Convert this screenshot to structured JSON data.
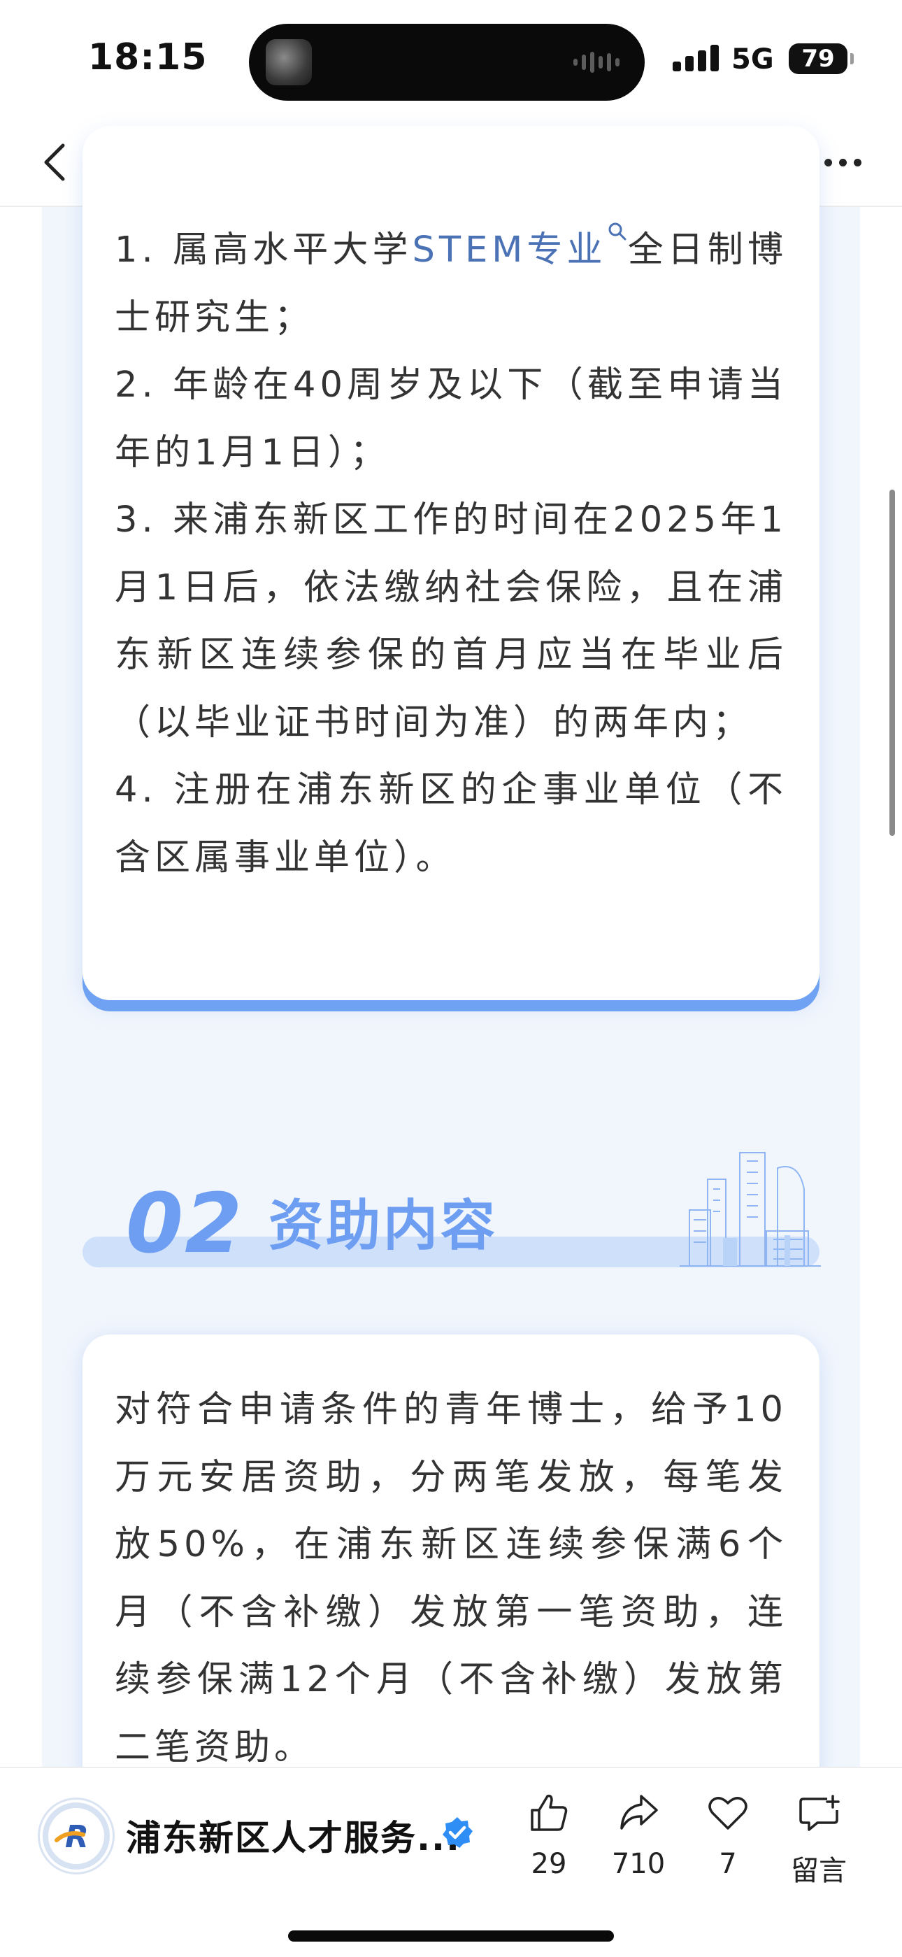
{
  "status_bar": {
    "time": "18:15",
    "network": "5G",
    "battery": "79"
  },
  "nav": {
    "back_icon": "chevron-left-icon",
    "more_icon": "more-dots-icon"
  },
  "section1": {
    "requirements": [
      {
        "prefix": "1. 属高水平大学",
        "link": "STEM专业",
        "suffix": "全日制博士研究生；"
      },
      {
        "text": "2. 年龄在40周岁及以下（截至申请当年的1月1日）；"
      },
      {
        "text": "3. 来浦东新区工作的时间在2025年1月1日后，依法缴纳社会保险，且在浦东新区连续参保的首月应当在毕业后（以毕业证书时间为准）的两年内；"
      },
      {
        "text": "4. 注册在浦东新区的企事业单位（不含区属事业单位）。"
      }
    ]
  },
  "section2": {
    "number": "02",
    "title": "资助内容",
    "body": "对符合申请条件的青年博士，给予10万元安居资助，分两笔发放，每笔发放50%，在浦东新区连续参保满6个月（不含补缴）发放第一笔资助，连续参保满12个月（不含补缴）发放第二笔资助。"
  },
  "footer": {
    "account_name": "浦东新区人才服务...",
    "actions": [
      {
        "icon": "thumbs-up-icon",
        "label": "29"
      },
      {
        "icon": "share-icon",
        "label": "710"
      },
      {
        "icon": "heart-icon",
        "label": "7"
      },
      {
        "icon": "comment-add-icon",
        "label": "留言"
      }
    ]
  },
  "colors": {
    "accent": "#6e9ef2",
    "link": "#4a72b5",
    "page_bg": "#f1f6fd"
  }
}
